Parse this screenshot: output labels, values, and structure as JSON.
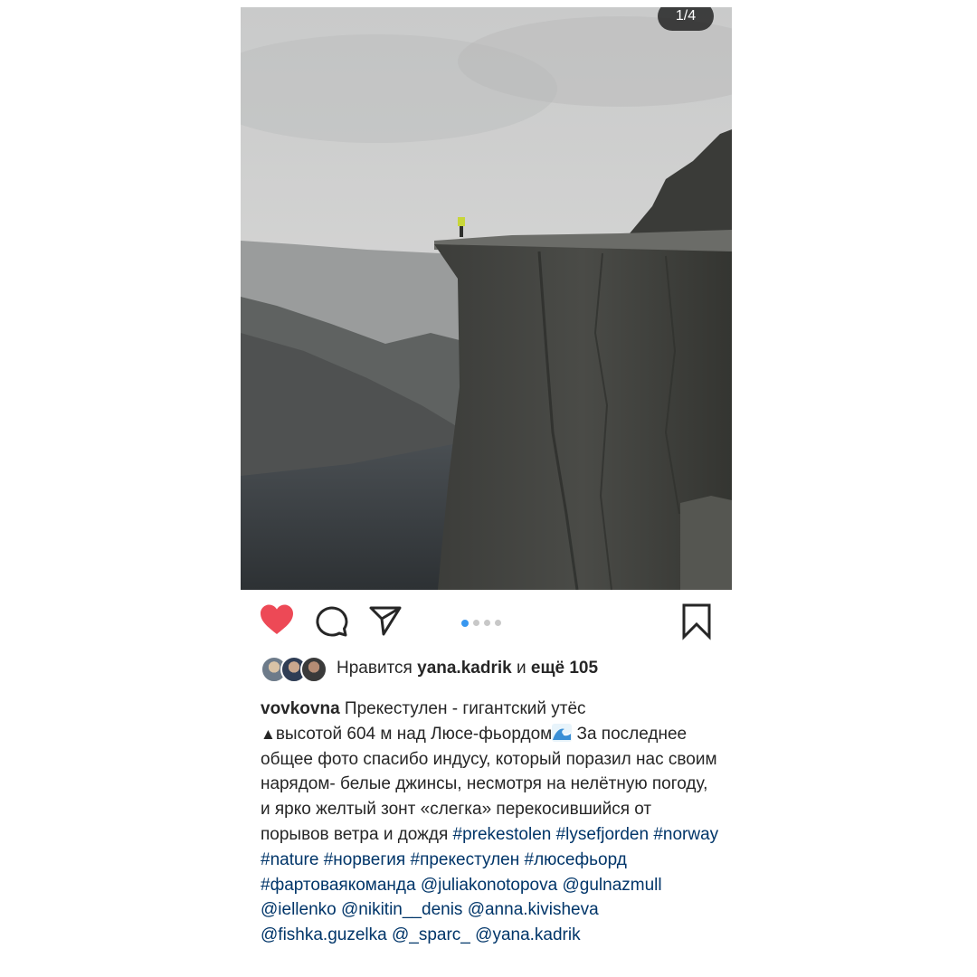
{
  "carousel": {
    "counter": "1/4",
    "total_dots": 4,
    "active_dot": 1
  },
  "photo": {
    "description_icon": "landscape-photo"
  },
  "actions": {
    "like_icon": "heart-icon",
    "comment_icon": "comment-icon",
    "share_icon": "send-icon",
    "save_icon": "bookmark-icon",
    "liked": true,
    "like_color": "#ed4956"
  },
  "likes": {
    "prefix": "Нравится",
    "user": "yana.kadrik",
    "middle": "и",
    "rest": "ещё 105"
  },
  "caption": {
    "username": "vovkovna",
    "line1": " Прекестулен - гигантский утёс",
    "triangle": "▲",
    "line2": "высотой 604 м над Люсе-фьордом",
    "text3": "  За последнее общее фото спасибо индусу, который поразил нас своим нарядом- белые джинсы, несмотря на нелётную погоду, и ярко желтый зонт «слегка» перекосившийся от порывов ветра и дождя  ",
    "hashtags": [
      "#prekestolen",
      "#lysefjorden",
      "#norway",
      "#nature",
      "#норвегия",
      "#прекестулен",
      "#люсефьорд",
      "#фартоваякоманда"
    ],
    "mentions": [
      "@juliakonotopova",
      "@gulnazmull",
      "@iellenko",
      "@nikitin__denis",
      "@anna.kivisheva",
      "@fishka.guzelka",
      "@_sparc_",
      "@yana.kadrik"
    ]
  },
  "colors": {
    "link": "#003569",
    "dot_active": "#3897f0",
    "dot": "#c8c8c8"
  }
}
